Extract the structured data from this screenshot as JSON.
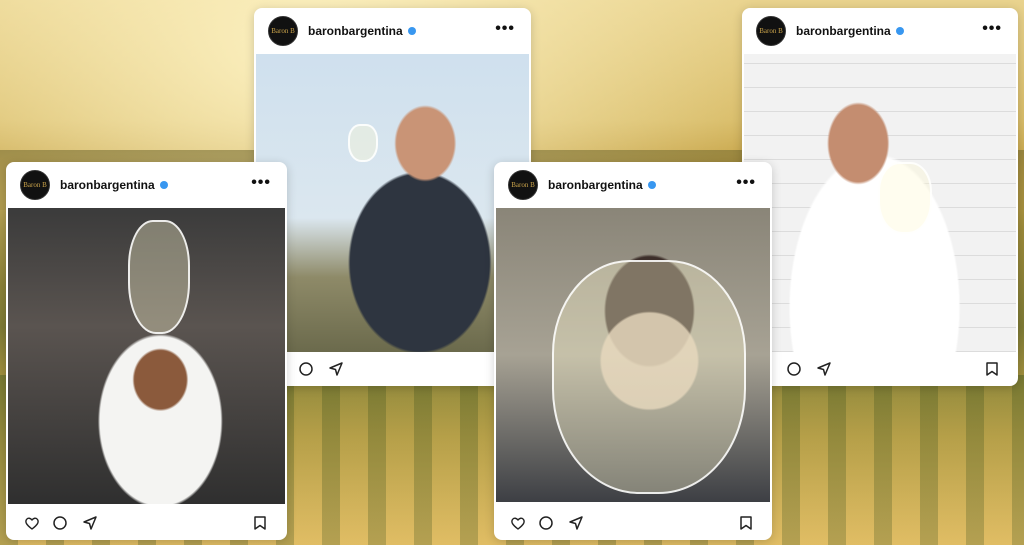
{
  "background": {
    "description_colors": [
      "#e9d38e",
      "#7e7a35",
      "#e3c46d"
    ]
  },
  "posts": [
    {
      "avatar_text": "Baron B",
      "username": "baronbargentina",
      "more": "•••",
      "photo": "chef-in-kitchen-toasting"
    },
    {
      "avatar_text": "Baron B",
      "username": "baronbargentina",
      "more": "•••",
      "photo": "man-tasting-wine-outdoors"
    },
    {
      "avatar_text": "Baron B",
      "username": "baronbargentina",
      "more": "•••",
      "photo": "woman-behind-large-glass"
    },
    {
      "avatar_text": "Baron B",
      "username": "baronbargentina",
      "more": "•••",
      "photo": "chef-holding-glass"
    }
  ],
  "icons": {
    "like": "heart-icon",
    "comment": "comment-icon",
    "share": "send-icon",
    "save": "bookmark-icon"
  },
  "colors": {
    "verified": "#3897f0",
    "avatar_bg": "#111111",
    "text": "#111111"
  }
}
